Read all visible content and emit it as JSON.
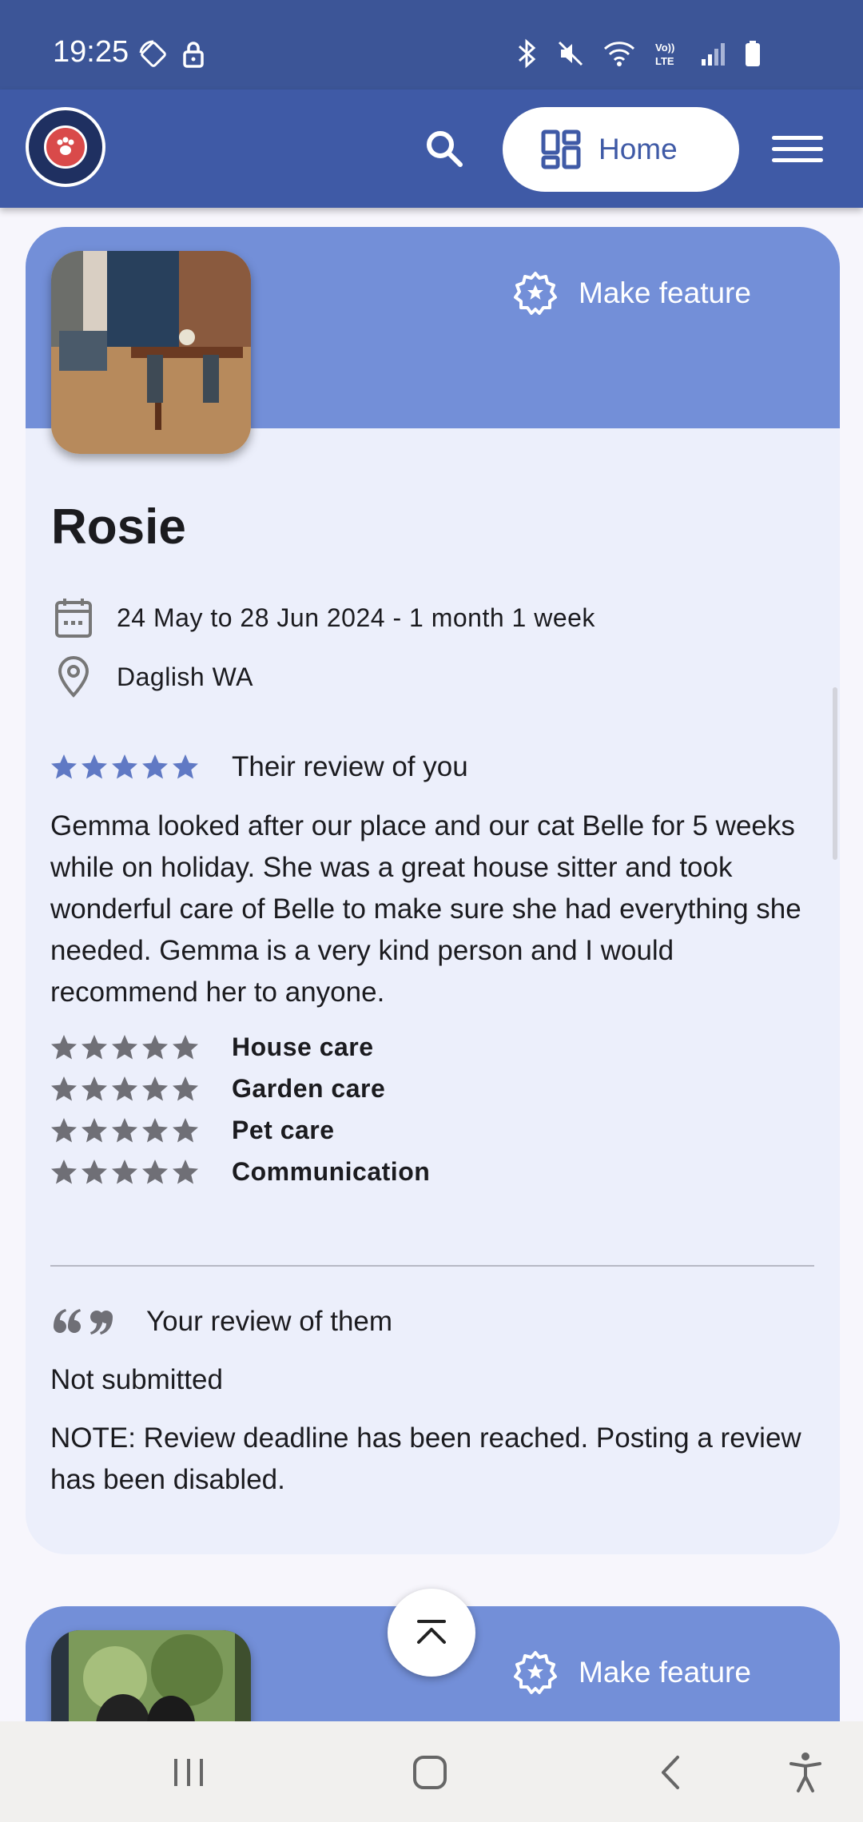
{
  "status_bar": {
    "time": "19:25"
  },
  "header": {
    "logo_alt": "AUSSIE HOUSE SITTERS",
    "home_label": "Home"
  },
  "cards": [
    {
      "feature_label": "Make feature",
      "name": "Rosie",
      "dates": "24 May to 28 Jun 2024 - 1 month 1 week",
      "location": "Daglish WA",
      "their_review_label": "Their review of you",
      "their_review_text": "Gemma looked after our place and our cat Belle for 5 weeks while on holiday. She was a great house sitter and took wonderful care of Belle to make sure she had everything she needed. Gemma is a very kind person and I would recommend her to anyone.",
      "overall_rating": 5,
      "ratings": [
        {
          "label": "House care",
          "stars": 5
        },
        {
          "label": "Garden care",
          "stars": 5
        },
        {
          "label": "Pet care",
          "stars": 5
        },
        {
          "label": "Communication",
          "stars": 5
        }
      ],
      "your_review_label": "Your review of them",
      "your_review_status": "Not submitted",
      "note": "NOTE: Review deadline has been reached. Posting a review has been disabled."
    },
    {
      "feature_label": "Make feature"
    }
  ],
  "colors": {
    "status_bar": "#3c5597",
    "header": "#3f5aa6",
    "card_top": "#738fd8",
    "card_bg": "#eceffb",
    "star_blue": "#6079c4",
    "star_grey": "#6f6f76"
  }
}
